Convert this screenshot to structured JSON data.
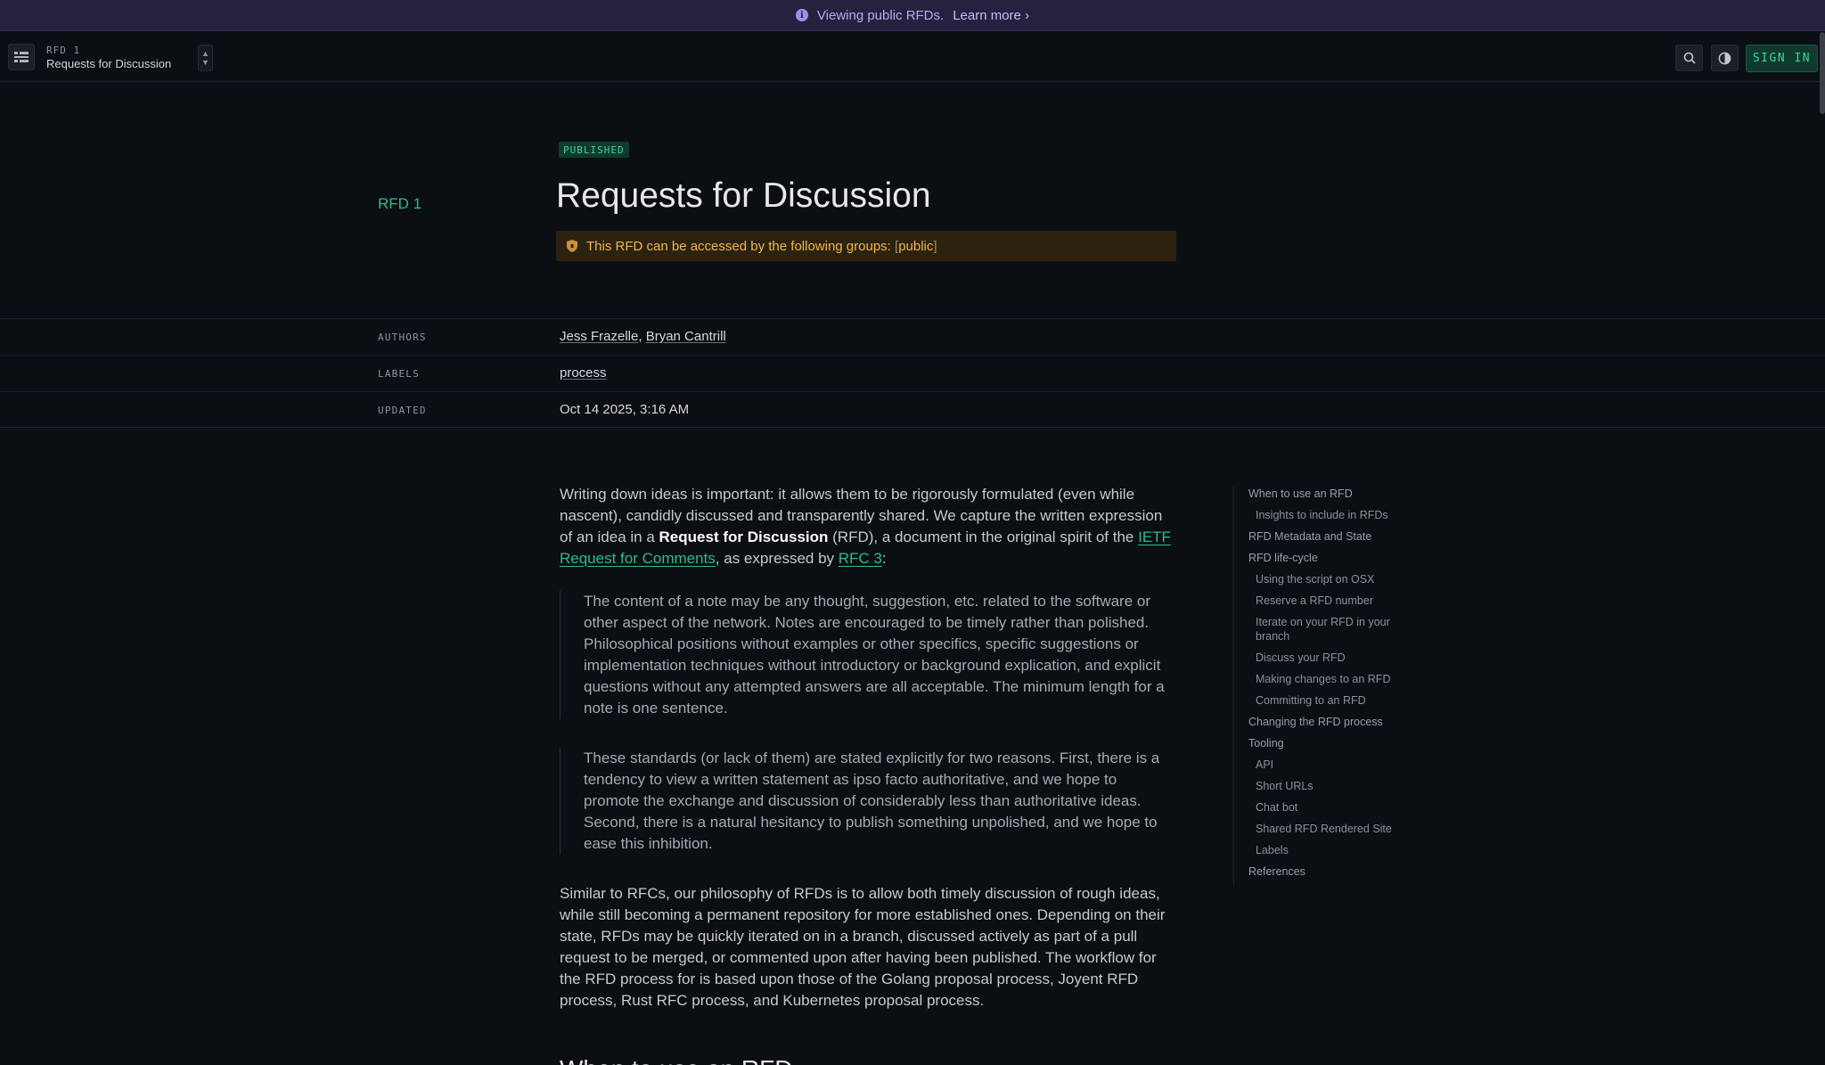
{
  "banner": {
    "text": "Viewing public RFDs.",
    "link": "Learn more",
    "link_chevron": "›"
  },
  "header": {
    "rfd_number": "RFD 1",
    "rfd_title": "Requests for Discussion",
    "signin_label": "SIGN IN",
    "menu_icon": "sidebar-toggle-icon",
    "search_icon": "search-icon",
    "theme_icon": "theme-toggle-icon"
  },
  "doc": {
    "state": "PUBLISHED",
    "side_number": "RFD 1",
    "title": "Requests for Discussion",
    "access_text": "This RFD can be accessed by the following groups:",
    "access_open": "[",
    "access_group": "public",
    "access_close": "]"
  },
  "meta": {
    "authors_label": "AUTHORS",
    "authors": [
      "Jess Frazelle",
      "Bryan Cantrill"
    ],
    "authors_sep": ",",
    "labels_label": "LABELS",
    "labels": [
      "process"
    ],
    "updated_label": "UPDATED",
    "updated": "Oct 14 2025, 3:16 AM"
  },
  "content": {
    "p1_a": "Writing down ideas is important: it allows them to be rigorously formulated (even while nascent), candidly discussed and transparently shared. We capture the written expression of an idea in a ",
    "p1_bold": "Request for Discussion",
    "p1_b": " (RFD), a document in the original spirit of the ",
    "p1_link1": "IETF Request for Comments",
    "p1_c": ", as expressed by ",
    "p1_link2": "RFC 3",
    "p1_d": ":",
    "quote1": "The content of a note may be any thought, suggestion, etc. related to the software or other aspect of the network. Notes are encouraged to be timely rather than polished. Philosophical positions without examples or other specifics, specific suggestions or implementation techniques without introductory or background explication, and explicit questions without any attempted answers are all acceptable. The minimum length for a note is one sentence.",
    "quote2": "These standards (or lack of them) are stated explicitly for two reasons. First, there is a tendency to view a written statement as ipso facto authoritative, and we hope to promote the exchange and discussion of considerably less than authoritative ideas. Second, there is a natural hesitancy to publish something unpolished, and we hope to ease this inhibition.",
    "p2": "Similar to RFCs, our philosophy of RFDs is to allow both timely discussion of rough ideas, while still becoming a permanent repository for more established ones. Depending on their state, RFDs may be quickly iterated on in a branch, discussed actively as part of a pull request to be merged, or commented upon after having been published. The workflow for the RFD process for is based upon those of the Golang proposal process, Joyent RFD process, Rust RFC process, and Kubernetes proposal process.",
    "next_heading": "When to use an RFD"
  },
  "toc": [
    {
      "label": "When to use an RFD",
      "sub": false
    },
    {
      "label": "Insights to include in RFDs",
      "sub": true
    },
    {
      "label": "RFD Metadata and State",
      "sub": false
    },
    {
      "label": "RFD life-cycle",
      "sub": false
    },
    {
      "label": "Using the script on OSX",
      "sub": true
    },
    {
      "label": "Reserve a RFD number",
      "sub": true
    },
    {
      "label": "Iterate on your RFD in your branch",
      "sub": true
    },
    {
      "label": "Discuss your RFD",
      "sub": true
    },
    {
      "label": "Making changes to an RFD",
      "sub": true
    },
    {
      "label": "Committing to an RFD",
      "sub": true
    },
    {
      "label": "Changing the RFD process",
      "sub": false
    },
    {
      "label": "Tooling",
      "sub": false
    },
    {
      "label": "API",
      "sub": true
    },
    {
      "label": "Short URLs",
      "sub": true
    },
    {
      "label": "Chat bot",
      "sub": true
    },
    {
      "label": "Shared RFD Rendered Site",
      "sub": true
    },
    {
      "label": "Labels",
      "sub": true
    },
    {
      "label": "References",
      "sub": false
    }
  ]
}
